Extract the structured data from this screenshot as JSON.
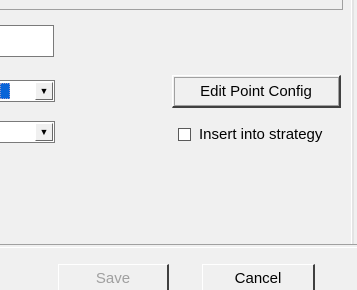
{
  "form": {
    "text_value": "",
    "combo1_value": "",
    "combo2_value": "",
    "combo_arrow_icon": "chevron-down-icon",
    "edit_point_config_label": "Edit Point Config",
    "insert_into_strategy_label": "Insert into strategy",
    "insert_into_strategy_checked": false
  },
  "footer": {
    "save_label": "Save",
    "save_enabled": false,
    "cancel_label": "Cancel"
  },
  "colors": {
    "selection": "#0a64d8",
    "disabled_text": "#a0a0a0",
    "background": "#f0f0f0"
  }
}
